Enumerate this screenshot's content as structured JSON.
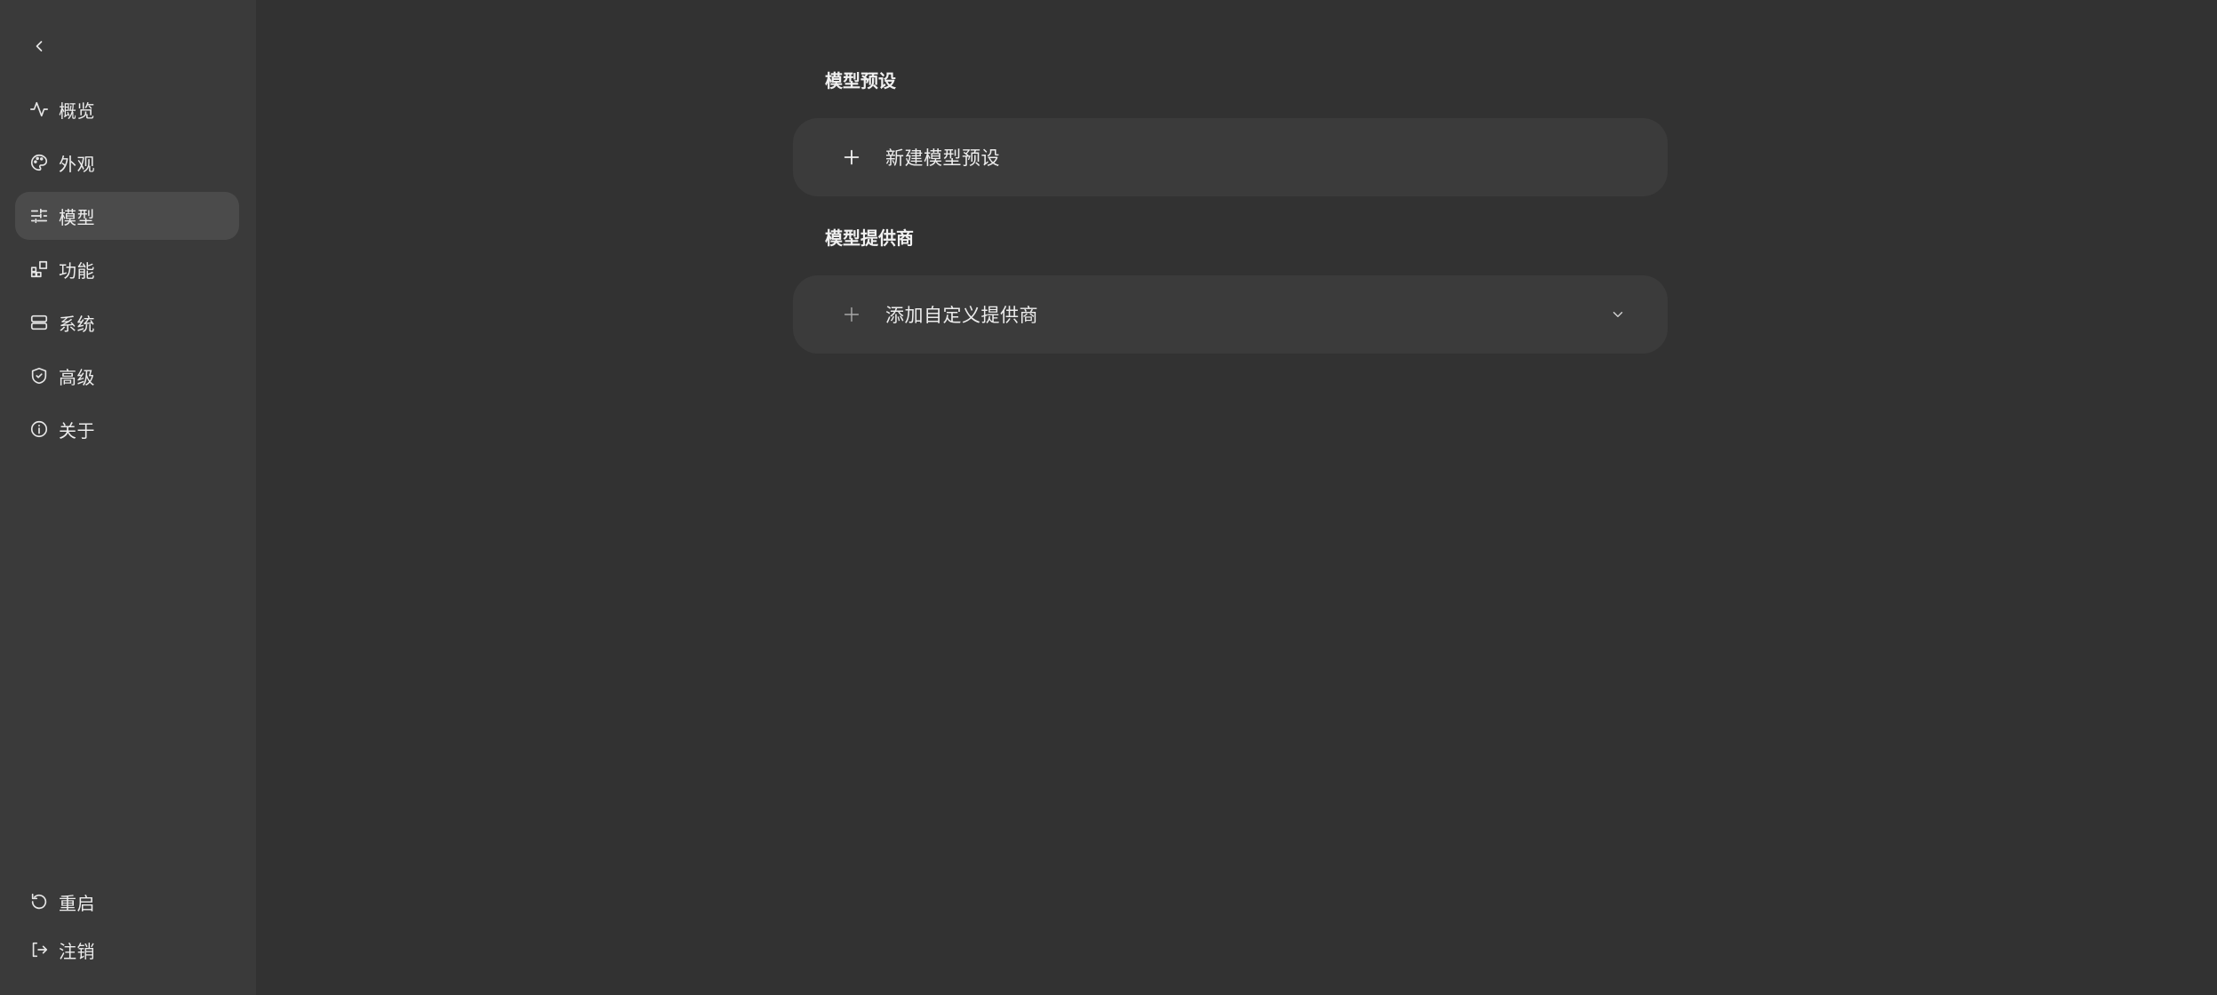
{
  "sidebar": {
    "items": [
      {
        "label": "概览",
        "icon": "activity-icon",
        "active": false
      },
      {
        "label": "外观",
        "icon": "palette-icon",
        "active": false
      },
      {
        "label": "模型",
        "icon": "sliders-icon",
        "active": true
      },
      {
        "label": "功能",
        "icon": "blocks-icon",
        "active": false
      },
      {
        "label": "系统",
        "icon": "server-icon",
        "active": false
      },
      {
        "label": "高级",
        "icon": "shield-check-icon",
        "active": false
      },
      {
        "label": "关于",
        "icon": "info-icon",
        "active": false
      }
    ],
    "bottom": [
      {
        "label": "重启",
        "icon": "restart-icon"
      },
      {
        "label": "注销",
        "icon": "logout-icon"
      }
    ]
  },
  "main": {
    "presets": {
      "title": "模型预设",
      "new_label": "新建模型预设"
    },
    "providers": {
      "title": "模型提供商",
      "add_label": "添加自定义提供商"
    }
  },
  "colors": {
    "background": "#323232",
    "sidebar": "#3a3a3a",
    "active_item": "#4b4b4b",
    "card": "#3b3b3b",
    "text": "#ececec"
  }
}
